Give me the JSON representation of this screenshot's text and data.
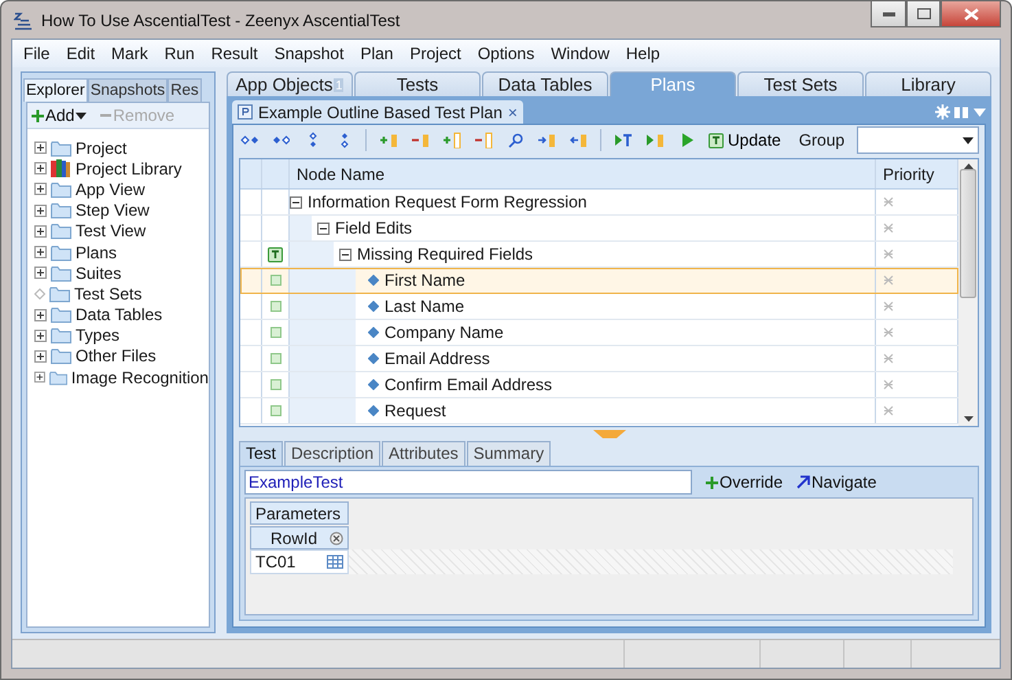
{
  "window": {
    "title": "How To Use AscentialTest - Zeenyx AscentialTest"
  },
  "menu": [
    "File",
    "Edit",
    "Mark",
    "Run",
    "Result",
    "Snapshot",
    "Plan",
    "Project",
    "Options",
    "Window",
    "Help"
  ],
  "explorer": {
    "tabs": [
      {
        "label": "Explorer",
        "selected": true
      },
      {
        "label": "Snapshots",
        "selected": false
      },
      {
        "label": "Res",
        "selected": false
      }
    ],
    "add": "Add",
    "remove": "Remove",
    "items": [
      {
        "label": "Project",
        "kind": "folder",
        "expandable": true
      },
      {
        "label": "Project Library",
        "kind": "library",
        "expandable": true
      },
      {
        "label": "App View",
        "kind": "folder",
        "expandable": true
      },
      {
        "label": "Step View",
        "kind": "folder",
        "expandable": true
      },
      {
        "label": "Test View",
        "kind": "folder",
        "expandable": true
      },
      {
        "label": "Plans",
        "kind": "folder",
        "expandable": true
      },
      {
        "label": "Suites",
        "kind": "folder",
        "expandable": true
      },
      {
        "label": "Test Sets",
        "kind": "folder",
        "expandable": false
      },
      {
        "label": "Data Tables",
        "kind": "folder",
        "expandable": true
      },
      {
        "label": "Types",
        "kind": "folder",
        "expandable": true
      },
      {
        "label": "Other Files",
        "kind": "folder",
        "expandable": true
      },
      {
        "label": "Image Recognition",
        "kind": "folder",
        "expandable": true
      }
    ]
  },
  "main_tabs": [
    {
      "label": "App Objects",
      "badge": "1",
      "selected": false
    },
    {
      "label": "Tests",
      "selected": false
    },
    {
      "label": "Data Tables",
      "selected": false
    },
    {
      "label": "Plans",
      "selected": true
    },
    {
      "label": "Test Sets",
      "selected": false
    },
    {
      "label": "Library",
      "selected": false
    }
  ],
  "document": {
    "title": "Example Outline Based Test Plan",
    "close": "×"
  },
  "toolbar": {
    "update": "Update",
    "group_label": "Group"
  },
  "grid": {
    "columns": [
      "Node Name",
      "Priority"
    ],
    "rows": [
      {
        "name": "Information Request Form Regression",
        "selected": false,
        "expanded": true,
        "children": [
          {
            "name": "Field Edits",
            "selected": false,
            "expanded": true,
            "children": [
              {
                "name": "Missing Required Fields",
                "kind": "test",
                "selected": false,
                "expanded": true,
                "children": [
                  {
                    "name": "First Name",
                    "kind": "step",
                    "selected": true
                  },
                  {
                    "name": "Last Name",
                    "kind": "step",
                    "selected": false
                  },
                  {
                    "name": "Company Name",
                    "kind": "step",
                    "selected": false
                  },
                  {
                    "name": "Email Address",
                    "kind": "step",
                    "selected": false
                  },
                  {
                    "name": "Confirm Email Address",
                    "kind": "step",
                    "selected": false
                  },
                  {
                    "name": "Request",
                    "kind": "step",
                    "selected": false
                  }
                ]
              }
            ]
          }
        ]
      }
    ]
  },
  "detail_tabs": [
    {
      "label": "Test",
      "selected": true
    },
    {
      "label": "Description",
      "selected": false
    },
    {
      "label": "Attributes",
      "selected": false
    },
    {
      "label": "Summary",
      "selected": false
    }
  ],
  "test_field": {
    "value": "ExampleTest"
  },
  "override": "Override",
  "navigate": "Navigate",
  "parameters": {
    "title": "Parameters",
    "column": "RowId",
    "rows": [
      "TC01"
    ]
  }
}
